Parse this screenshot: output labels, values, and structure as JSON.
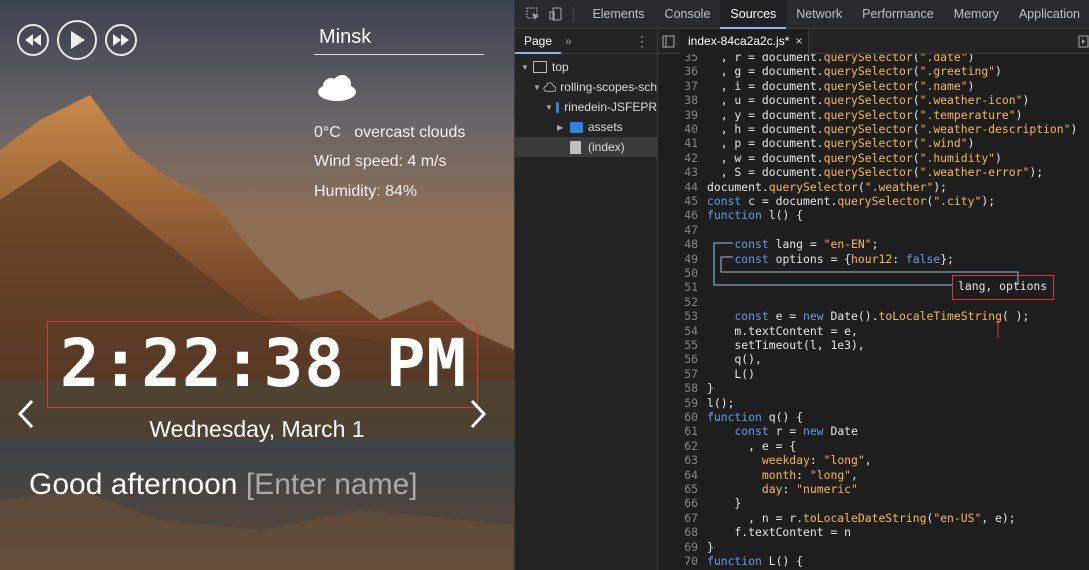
{
  "app": {
    "player": {
      "prev_icon": "skip-back-icon",
      "play_icon": "play-icon",
      "next_icon": "skip-forward-icon"
    },
    "weather": {
      "city": "Minsk",
      "icon": "cloud-icon",
      "temperature": "0°C",
      "description": "overcast clouds",
      "wind": "Wind speed: 4 m/s",
      "humidity": "Humidity: 84%"
    },
    "time": "2:22:38 PM",
    "date": "Wednesday, March 1",
    "greeting": "Good afternoon",
    "name_placeholder": "[Enter name]",
    "accent_color": "#d93838"
  },
  "devtools": {
    "tabs": [
      "Elements",
      "Console",
      "Sources",
      "Network",
      "Performance",
      "Memory",
      "Application"
    ],
    "active_tab": "Sources",
    "navigator": {
      "page_tab": "Page",
      "more": "»",
      "tree": [
        {
          "label": "top",
          "depth": 0
        },
        {
          "label": "rolling-scopes-sch",
          "depth": 1
        },
        {
          "label": "rinedein-JSFEPR",
          "depth": 2
        },
        {
          "label": "assets",
          "depth": 3
        },
        {
          "label": "(index)",
          "depth": 3
        }
      ]
    },
    "editor": {
      "file_tab": "index-84ca2a2c.js*",
      "close": "×",
      "lines": [
        {
          "n": "35",
          "t": "  , r = document.querySelector(\".date\")"
        },
        {
          "n": "36",
          "t": "  , g = document.querySelector(\".greeting\")"
        },
        {
          "n": "37",
          "t": "  , i = document.querySelector(\".name\")"
        },
        {
          "n": "38",
          "t": "  , u = document.querySelector(\".weather-icon\")"
        },
        {
          "n": "39",
          "t": "  , y = document.querySelector(\".temperature\")"
        },
        {
          "n": "40",
          "t": "  , h = document.querySelector(\".weather-description\")"
        },
        {
          "n": "41",
          "t": "  , p = document.querySelector(\".wind\")"
        },
        {
          "n": "42",
          "t": "  , w = document.querySelector(\".humidity\")"
        },
        {
          "n": "43",
          "t": "  , S = document.querySelector(\".weather-error\");"
        },
        {
          "n": "44",
          "t": "document.querySelector(\".weather\");"
        },
        {
          "n": "45",
          "t": "const c = document.querySelector(\".city\");"
        },
        {
          "n": "46",
          "t": "function l() {"
        },
        {
          "n": "47",
          "t": ""
        },
        {
          "n": "48",
          "t": "    const lang = \"en-EN\";"
        },
        {
          "n": "49",
          "t": "    const options = {hour12: false};"
        },
        {
          "n": "50",
          "t": ""
        },
        {
          "n": "51",
          "t": ""
        },
        {
          "n": "52",
          "t": ""
        },
        {
          "n": "53",
          "t": "    const e = new Date().toLocaleTimeString( );"
        },
        {
          "n": "54",
          "t": "    m.textContent = e,"
        },
        {
          "n": "55",
          "t": "    setTimeout(l, 1e3),"
        },
        {
          "n": "56",
          "t": "    q(),"
        },
        {
          "n": "57",
          "t": "    L()"
        },
        {
          "n": "58",
          "t": "}"
        },
        {
          "n": "59",
          "t": "l();"
        },
        {
          "n": "60",
          "t": "function q() {"
        },
        {
          "n": "61",
          "t": "    const r = new Date"
        },
        {
          "n": "62",
          "t": "      , e = {"
        },
        {
          "n": "63",
          "t": "        weekday: \"long\","
        },
        {
          "n": "64",
          "t": "        month: \"long\","
        },
        {
          "n": "65",
          "t": "        day: \"numeric\""
        },
        {
          "n": "66",
          "t": "    }"
        },
        {
          "n": "67",
          "t": "      , n = r.toLocaleDateString(\"en-US\", e);"
        },
        {
          "n": "68",
          "t": "    f.textContent = n"
        },
        {
          "n": "69",
          "t": "}"
        },
        {
          "n": "70",
          "t": "function L() {"
        }
      ],
      "annotation": "lang, options"
    }
  }
}
